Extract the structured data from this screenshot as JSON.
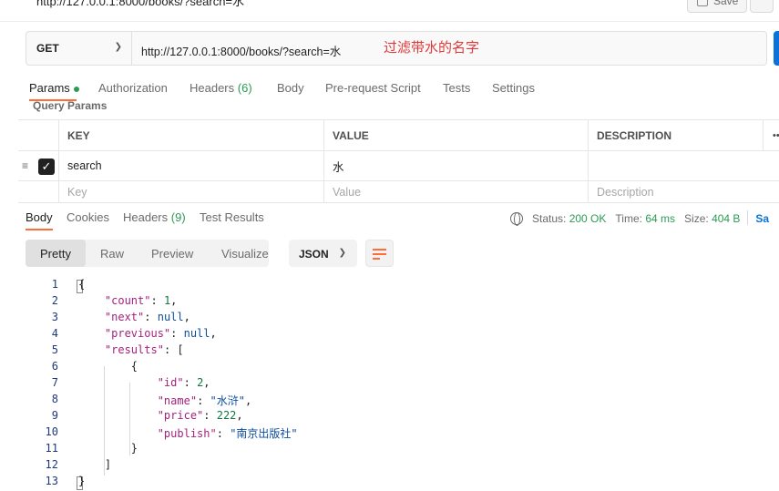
{
  "titlebar": {
    "request_name": "http://127.0.0.1:8000/books/?search=水",
    "save_label": "Save"
  },
  "request": {
    "method": "GET",
    "url": "http://127.0.0.1:8000/books/?search=水",
    "annotation": "过滤带水的名字"
  },
  "request_tabs": {
    "params": "Params",
    "authorization": "Authorization",
    "headers": "Headers",
    "headers_count": "(6)",
    "body": "Body",
    "prerequest": "Pre-request Script",
    "tests": "Tests",
    "settings": "Settings"
  },
  "query_params": {
    "label": "Query Params",
    "columns": [
      "KEY",
      "VALUE",
      "DESCRIPTION"
    ],
    "rows": [
      {
        "key": "search",
        "value": "水",
        "description": "",
        "checked": true
      }
    ],
    "placeholders": {
      "key": "Key",
      "value": "Value",
      "description": "Description"
    }
  },
  "response_tabs": {
    "body": "Body",
    "cookies": "Cookies",
    "headers": "Headers",
    "headers_count": "(9)",
    "test_results": "Test Results"
  },
  "response_status": {
    "status_label": "Status:",
    "status_value": "200 OK",
    "time_label": "Time:",
    "time_value": "64 ms",
    "size_label": "Size:",
    "size_value": "404 B",
    "save_label": "Sa"
  },
  "view": {
    "modes": [
      "Pretty",
      "Raw",
      "Preview",
      "Visualize"
    ],
    "active_mode": "Pretty",
    "format": "JSON"
  },
  "code_lines": [
    {
      "n": "1",
      "text": "{"
    },
    {
      "n": "2",
      "text": "    \"count\": 1,"
    },
    {
      "n": "3",
      "text": "    \"next\": null,"
    },
    {
      "n": "4",
      "text": "    \"previous\": null,"
    },
    {
      "n": "5",
      "text": "    \"results\": ["
    },
    {
      "n": "6",
      "text": "        {"
    },
    {
      "n": "7",
      "text": "            \"id\": 2,"
    },
    {
      "n": "8",
      "text": "            \"name\": \"水浒\","
    },
    {
      "n": "9",
      "text": "            \"price\": 222,"
    },
    {
      "n": "10",
      "text": "            \"publish\": \"南京出版社\""
    },
    {
      "n": "11",
      "text": "        }"
    },
    {
      "n": "12",
      "text": "    ]"
    },
    {
      "n": "13",
      "text": "}"
    }
  ],
  "colors": {
    "accent": "#ff6c37",
    "status_green": "#2c9b54",
    "annotation_red": "#e03a3a",
    "send_blue": "#0a72d8"
  },
  "icons": [
    "save-icon",
    "chevron-down-icon",
    "drag-handle-icon",
    "checkbox-checked-icon",
    "more-icon",
    "globe-icon",
    "wrap-lines-icon"
  ]
}
